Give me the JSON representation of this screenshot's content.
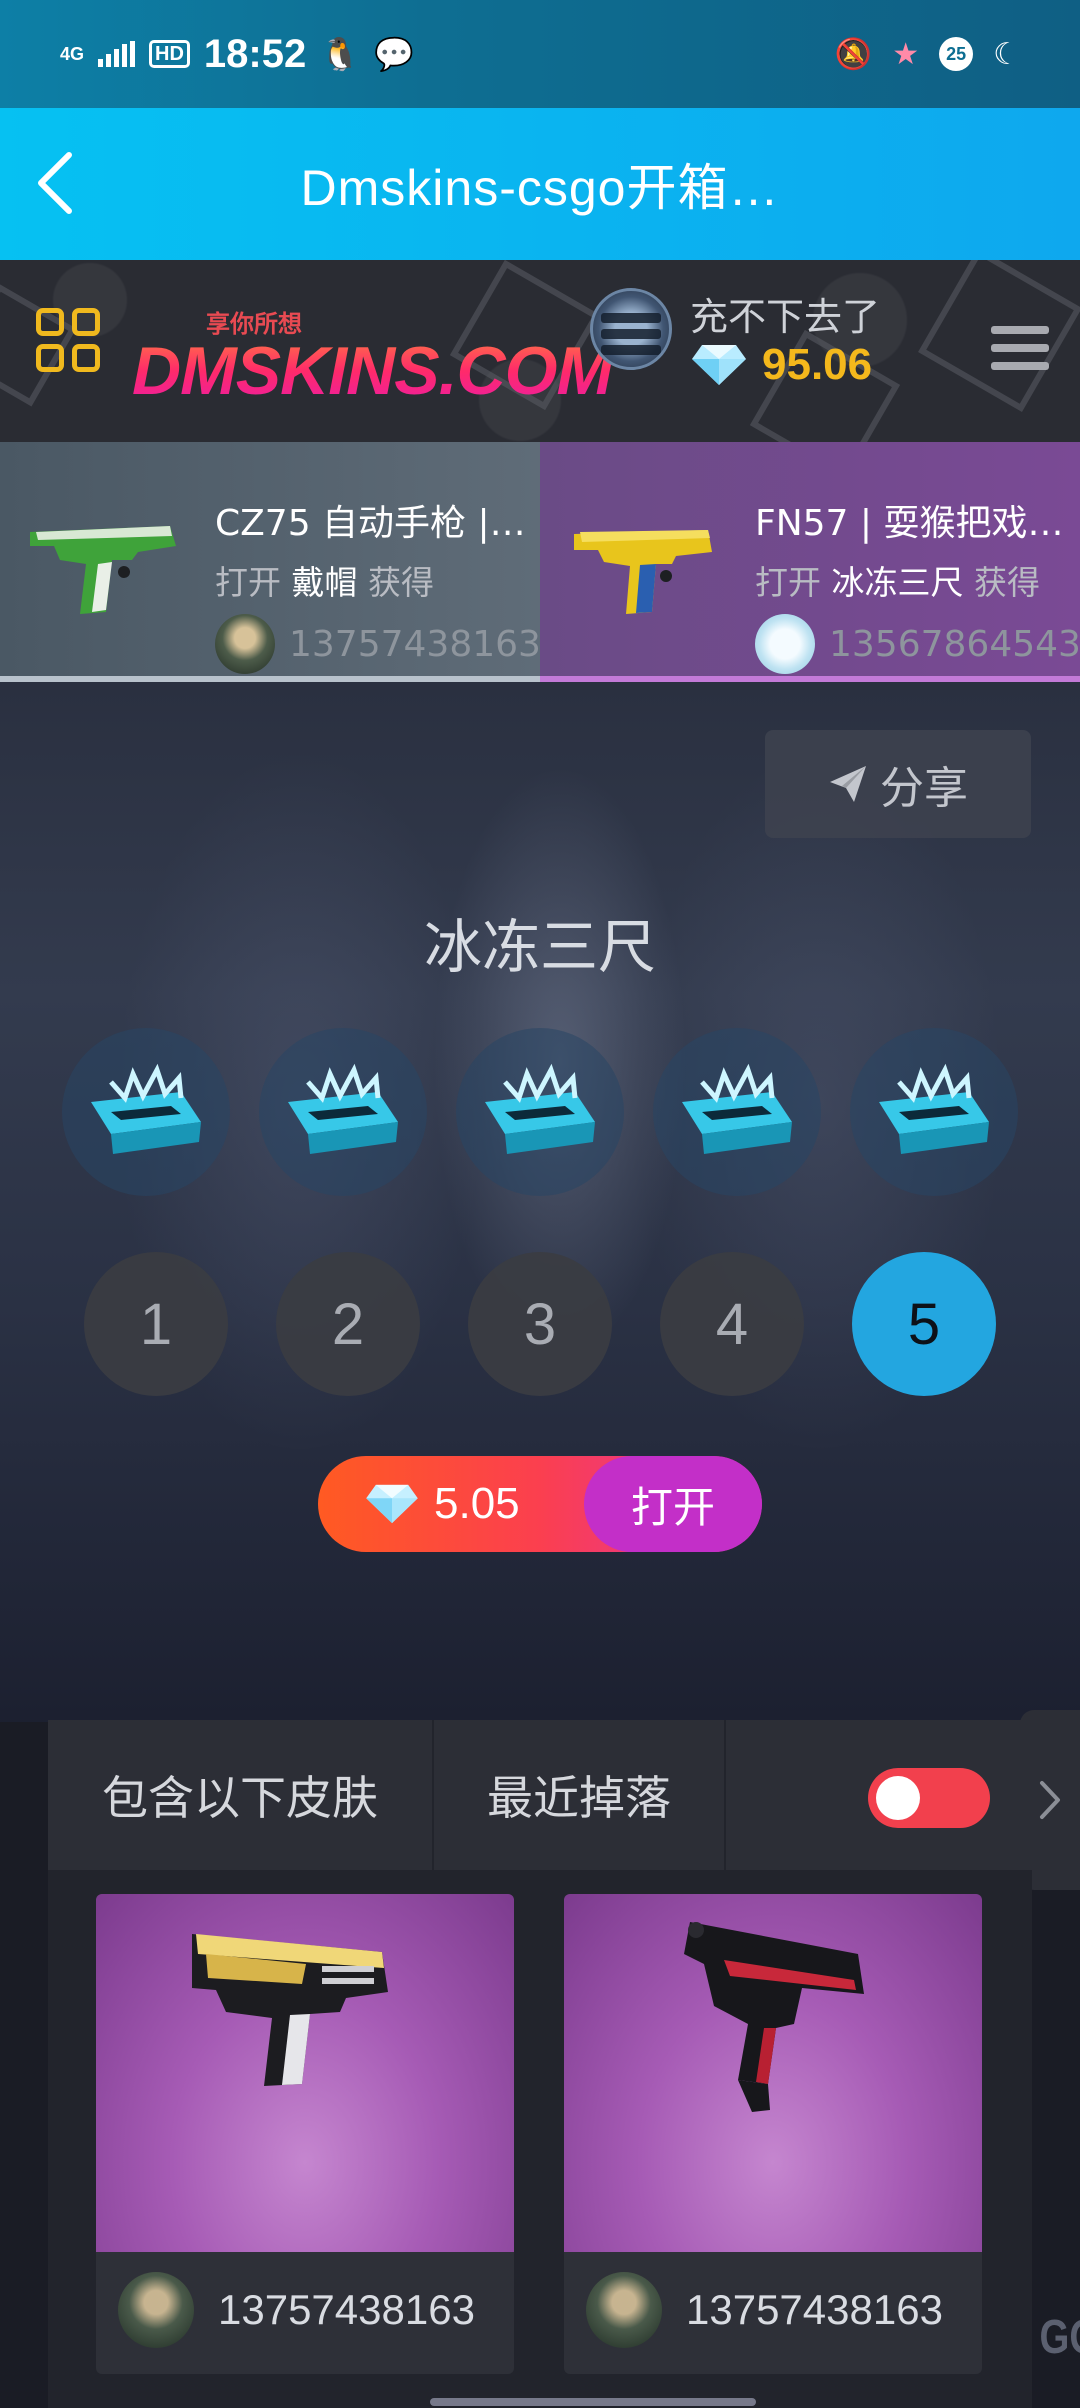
{
  "status_bar": {
    "network": "4G",
    "hd": "HD",
    "time": "18:52",
    "battery": "25",
    "icons": [
      "qq-icon",
      "wechat-icon",
      "mute-icon",
      "star-icon",
      "moon-icon"
    ]
  },
  "header": {
    "title": "Dmskins-csgo开箱…"
  },
  "site": {
    "logo_tagline": "享你所想",
    "logo_text": "DMSKINS.COM",
    "username": "充不下去了",
    "balance": "95.06",
    "accent": "#f4b81c"
  },
  "drops": [
    {
      "name": "CZ75 自动手枪 |…",
      "action": "打开",
      "case": "戴帽",
      "result": "获得",
      "phone": "13757438163"
    },
    {
      "name": "FN57 | 耍猴把戏…",
      "action": "打开",
      "case": "冰冻三尺",
      "result": "获得",
      "phone": "13567864543"
    }
  ],
  "main": {
    "share_label": "分享",
    "case_title": "冰冻三尺",
    "quantities": [
      "1",
      "2",
      "3",
      "4",
      "5"
    ],
    "selected_quantity": "5",
    "price": "5.05",
    "open_label": "打开"
  },
  "tabs": {
    "contains": "包含以下皮肤",
    "recent": "最近掉落",
    "toggle_on": true
  },
  "skins": [
    {
      "phone": "13757438163",
      "weapon": "desert-eagle"
    },
    {
      "phone": "13757438163",
      "weapon": "tec-9"
    }
  ],
  "watermark": "GO"
}
